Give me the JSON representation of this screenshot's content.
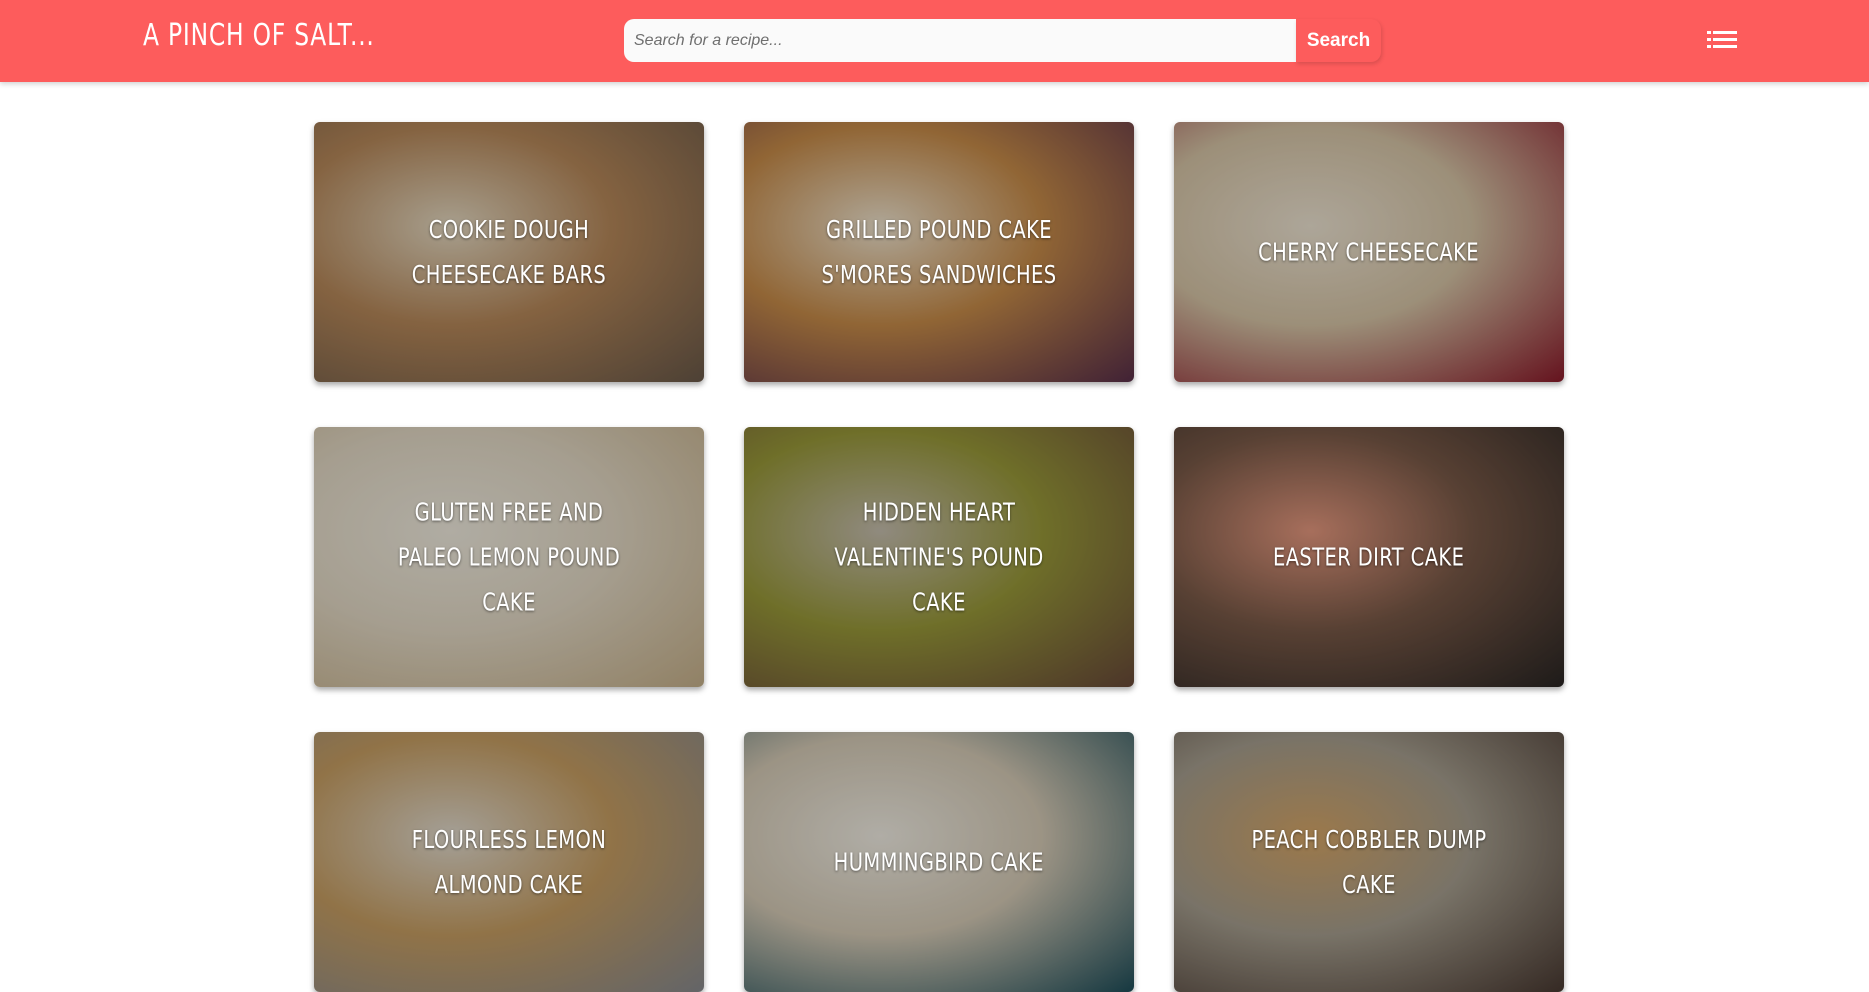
{
  "header": {
    "logo": "A PINCH OF SALT...",
    "search_placeholder": "Search for a recipe...",
    "search_button": "Search",
    "menu_icon": "list-icon",
    "bar_color": "#fd5c5c"
  },
  "recipes": [
    {
      "title": "Cookie Dough Cheesecake Bars",
      "palette": [
        "#6b5a4a",
        "#b8895a",
        "#e8dcc4"
      ]
    },
    {
      "title": "Grilled Pound Cake S'mores Sandwiches",
      "palette": [
        "#5a2f4a",
        "#c98d4a",
        "#f2e6d0"
      ]
    },
    {
      "title": "Cherry Cheesecake",
      "palette": [
        "#8c1a2a",
        "#d9c7a8",
        "#f0e6d4"
      ]
    },
    {
      "title": "Gluten Free and Paleo Lemon Pound Cake",
      "palette": [
        "#c9b38c",
        "#e6dcc8",
        "#f4efe2"
      ]
    },
    {
      "title": "Hidden Heart Valentine's Pound Cake",
      "palette": [
        "#6a4a3a",
        "#9a9a3a",
        "#c8c0b0"
      ]
    },
    {
      "title": "Easter Dirt Cake",
      "palette": [
        "#2a2624",
        "#7a5a48",
        "#e89a80"
      ]
    },
    {
      "title": "Flourless Lemon Almond Cake",
      "palette": [
        "#8a8c90",
        "#c9a064",
        "#e4ddd0"
      ]
    },
    {
      "title": "Hummingbird Cake",
      "palette": [
        "#1e4e5a",
        "#d8cdb8",
        "#f4f0e6"
      ]
    },
    {
      "title": "Peach Cobbler Dump Cake",
      "palette": [
        "#4a3a32",
        "#a8a090",
        "#d8a868"
      ]
    }
  ]
}
